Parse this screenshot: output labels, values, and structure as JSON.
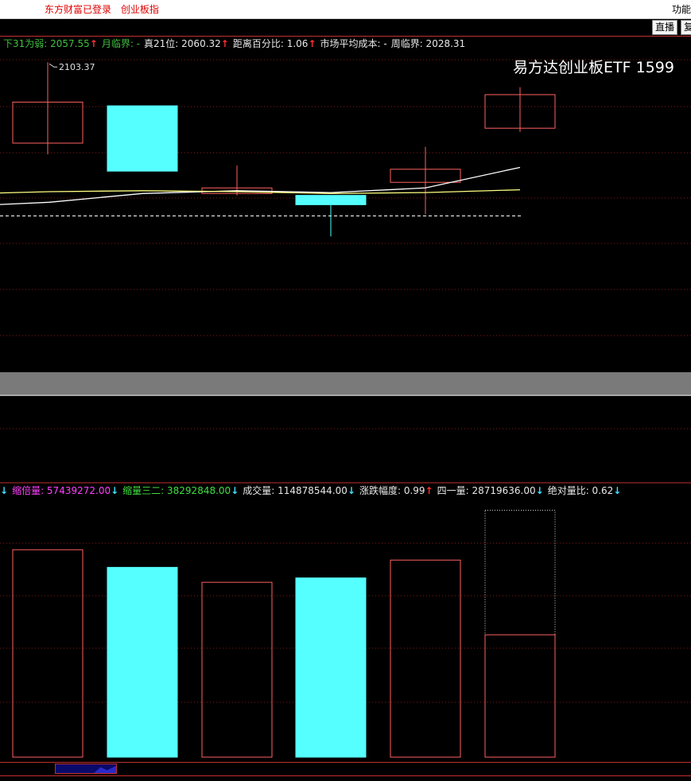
{
  "topbar": {
    "status": [
      "东方财富已登录",
      "创业板指"
    ],
    "function_label": "功能"
  },
  "toolbar": {
    "buttons": [
      "直播",
      "复"
    ]
  },
  "ticker": "易方达创业板ETF 1599",
  "price_indicators": [
    {
      "label": "下31为弱: 2057.55",
      "color": "#40c040",
      "arrow": "↑",
      "dir": "up"
    },
    {
      "label": "月临界: -",
      "color": "#40c040",
      "arrow": "",
      "dir": ""
    },
    {
      "label": "真21位: 2060.32",
      "color": "#e8e8e8",
      "arrow": "↑",
      "dir": "up"
    },
    {
      "label": "距离百分比: 1.06",
      "color": "#e8e8e8",
      "arrow": "↑",
      "dir": "up"
    },
    {
      "label": "市场平均成本: -",
      "color": "#e8e8e8",
      "arrow": "",
      "dir": ""
    },
    {
      "label": "周临界: 2028.31",
      "color": "#e8e8e8",
      "arrow": "",
      "dir": ""
    }
  ],
  "volume_indicators": [
    {
      "label": "",
      "color": "#40e0ff",
      "arrow": "↓",
      "dir": "dn"
    },
    {
      "label": "缩倍量: 57439272.00",
      "color": "#ff40ff",
      "arrow": "↓",
      "dir": "dn"
    },
    {
      "label": "缩量三二: 38292848.00",
      "color": "#40e040",
      "arrow": "↓",
      "dir": "dn"
    },
    {
      "label": "成交量: 114878544.00",
      "color": "#e8e8e8",
      "arrow": "↓",
      "dir": "dn"
    },
    {
      "label": "涨跌幅度: 0.99",
      "color": "#e8e8e8",
      "arrow": "↑",
      "dir": "up"
    },
    {
      "label": "四一量: 28719636.00",
      "color": "#e8e8e8",
      "arrow": "↓",
      "dir": "dn"
    },
    {
      "label": "绝对量比: 0.62",
      "color": "#e8e8e8",
      "arrow": "↓",
      "dir": "dn"
    }
  ],
  "colors": {
    "up": "#ff6060",
    "down": "#55ffff",
    "grid": "#8a1a1a",
    "ma_white": "#ffffff",
    "ma_yellow": "#ffff80"
  },
  "chart_data": [
    {
      "type": "candlestick",
      "title": "",
      "annotations": [
        "2103.37"
      ],
      "candles": [
        {
          "open": 2060,
          "close": 2082,
          "high": 2103.37,
          "low": 2054,
          "dir": "up"
        },
        {
          "open": 2080,
          "close": 2045,
          "high": 2080,
          "low": 2045,
          "dir": "down"
        },
        {
          "open": 2033,
          "close": 2036,
          "high": 2048,
          "low": 2032,
          "dir": "up"
        },
        {
          "open": 2032,
          "close": 2027,
          "high": 2032,
          "low": 2010,
          "dir": "down"
        },
        {
          "open": 2039,
          "close": 2046,
          "high": 2058,
          "low": 2022,
          "dir": "up"
        },
        {
          "open": 2068,
          "close": 2086,
          "high": 2090,
          "low": 2066,
          "dir": "up"
        }
      ],
      "lines": [
        {
          "color": "white",
          "values": [
            2028.31,
            2033,
            2034.5,
            2033.5,
            2036,
            2047
          ]
        },
        {
          "color": "yellow",
          "values": [
            2034,
            2034.5,
            2034,
            2033,
            2033.5,
            2035
          ]
        }
      ],
      "dashed_level": 2021,
      "ylim": [
        1950,
        2112
      ]
    },
    {
      "type": "bar",
      "title": "",
      "values": [
        100000000,
        91500000,
        84300000,
        86400000,
        95000000,
        59000000
      ],
      "dirs": [
        "up",
        "down",
        "up",
        "down",
        "up",
        "up"
      ],
      "dotted_outline": 119000000,
      "ylim": [
        0,
        125000000
      ]
    }
  ]
}
